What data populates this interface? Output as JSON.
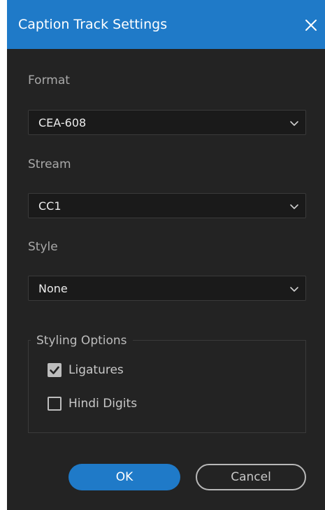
{
  "dialog": {
    "title": "Caption Track Settings",
    "close_icon": "close-icon",
    "accent_color": "#1f7ac8",
    "background_color": "#232323"
  },
  "format": {
    "label": "Format",
    "value": "CEA-608",
    "icon": "chevron-down-icon"
  },
  "stream": {
    "label": "Stream",
    "value": "CC1",
    "icon": "chevron-down-icon"
  },
  "style": {
    "label": "Style",
    "value": "None",
    "icon": "chevron-down-icon"
  },
  "styling_options": {
    "legend": "Styling Options",
    "options": [
      {
        "label": "Ligatures",
        "checked": true
      },
      {
        "label": "Hindi Digits",
        "checked": false
      }
    ]
  },
  "buttons": {
    "ok": "OK",
    "cancel": "Cancel"
  }
}
